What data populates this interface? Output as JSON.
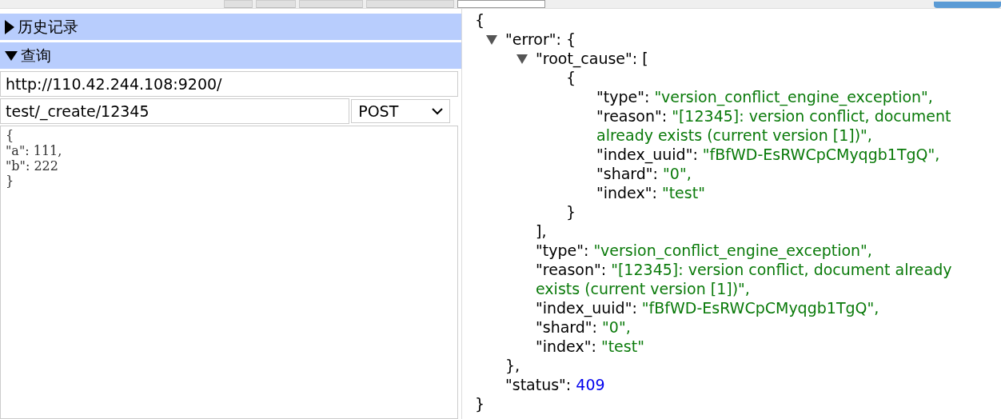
{
  "header": {
    "tabs": [
      {
        "selected": false
      },
      {
        "selected": false
      },
      {
        "selected": false
      },
      {
        "selected": false
      },
      {
        "selected": true
      }
    ]
  },
  "sections": [
    {
      "label": "历史记录",
      "expanded": false
    },
    {
      "label": "查询",
      "expanded": true
    }
  ],
  "query": {
    "url": "http://110.42.244.108:9200/",
    "path": "test/_create/12345",
    "method": "POST",
    "body": "{\n\"a\": 111,\n\"b\": 222\n}"
  },
  "response": {
    "open": "{",
    "close": "}",
    "children": [
      {
        "key": "\"error\":",
        "open": "{",
        "expanded": true,
        "close": "},",
        "children": [
          {
            "key": "\"root_cause\":",
            "open": "[",
            "expanded": true,
            "close": "],",
            "children": [
              {
                "open": "{",
                "close": "}",
                "children": [
                  {
                    "key": "\"type\":",
                    "value": "\"version_conflict_engine_exception\",",
                    "kind": "string"
                  },
                  {
                    "key": "\"reason\":",
                    "value": "\"[12345]: version conflict, document already exists (current version [1])\",",
                    "kind": "string"
                  },
                  {
                    "key": "\"index_uuid\":",
                    "value": "\"fBfWD-EsRWCpCMyqgb1TgQ\",",
                    "kind": "string"
                  },
                  {
                    "key": "\"shard\":",
                    "value": "\"0\",",
                    "kind": "string"
                  },
                  {
                    "key": "\"index\":",
                    "value": "\"test\"",
                    "kind": "string"
                  }
                ]
              }
            ]
          },
          {
            "key": "\"type\":",
            "value": "\"version_conflict_engine_exception\",",
            "kind": "string"
          },
          {
            "key": "\"reason\":",
            "value": "\"[12345]: version conflict, document already exists (current version [1])\",",
            "kind": "string"
          },
          {
            "key": "\"index_uuid\":",
            "value": "\"fBfWD-EsRWCpCMyqgb1TgQ\",",
            "kind": "string"
          },
          {
            "key": "\"shard\":",
            "value": "\"0\",",
            "kind": "string"
          },
          {
            "key": "\"index\":",
            "value": "\"test\"",
            "kind": "string"
          }
        ]
      },
      {
        "key": "\"status\":",
        "value": "409",
        "kind": "number"
      }
    ]
  }
}
